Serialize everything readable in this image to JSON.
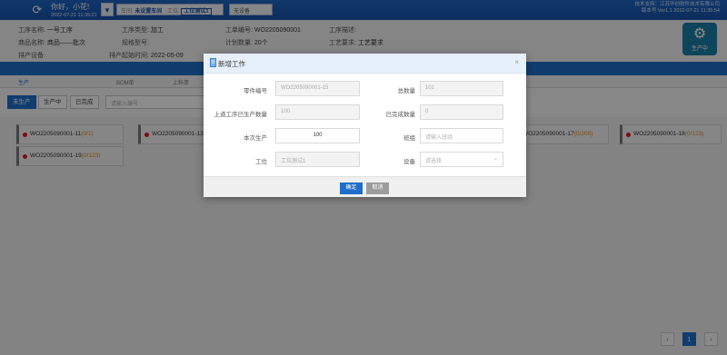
{
  "topbar": {
    "greeting": "你好，小花!",
    "datetime": "2022-07-21 11:35:21",
    "workshop_label": "车间:",
    "workshop_value": "未设置车间",
    "station_label": "工位:",
    "station_value": "工位测试1",
    "device_placeholder": "无设备",
    "company_line1": "技术支持：江苏华创软件技术有限公司",
    "company_line2": "版本号:Ver1.1 2022-07-21 11:35:54"
  },
  "info": {
    "process_name_k": "工序名称:",
    "process_name_v": "一号工序",
    "process_type_k": "工序类型:",
    "process_type_v": "加工",
    "order_no_k": "工单编号:",
    "order_no_v": "WO2205090001",
    "process_desc_k": "工序描述:",
    "process_desc_v": "",
    "product_name_k": "商品名称:",
    "product_name_v": "商品——批次",
    "spec_k": "规格型号:",
    "spec_v": "",
    "plan_qty_k": "计划数量:",
    "plan_qty_v": "20个",
    "proc_req_k": "工艺要求:",
    "proc_req_v": "工艺要求",
    "device_k": "排产设备:",
    "device_v": "",
    "start_time_k": "排产起始时间:",
    "start_time_v": "2022-05-09"
  },
  "gear_button": {
    "label": "生产中",
    "icon": "gear-icon"
  },
  "tabs": [
    "生产",
    "",
    "BOM单",
    "上料单",
    ""
  ],
  "filters": {
    "buttons": [
      "未生产",
      "生产中",
      "已完成"
    ],
    "search_placeholder": "请输入编号"
  },
  "cards": [
    {
      "code": "WO2205090001-11",
      "progress": "(0/1)"
    },
    {
      "code": "WO2205090001-13",
      "progress": ""
    },
    {
      "code": "WO2205090001-15",
      "progress": ""
    },
    {
      "code": "WO2205090001-17",
      "progress": "(0/200)"
    },
    {
      "code": "WO2205090001-18",
      "progress": "(0/123)"
    },
    {
      "code": "WO2205090001-19",
      "progress": "(0/123)"
    }
  ],
  "pagination": {
    "prev": "‹",
    "current": "1",
    "next": "›"
  },
  "modal": {
    "title": "新增工作",
    "close": "×",
    "fields": {
      "part_no_label": "零件编号",
      "part_no_value": "WO2205090001-15",
      "total_qty_label": "总数量",
      "total_qty_value": "101",
      "prev_produced_label": "上道工序已生产数量",
      "prev_produced_value": "100",
      "completed_label": "已完成数量",
      "completed_value": "0",
      "this_prod_label": "本次生产",
      "this_prod_value": "100",
      "team_label": "班组",
      "team_placeholder": "请输入班组",
      "station_label": "工位",
      "station_value": "工位测试1",
      "device_label": "设备",
      "device_placeholder": "请选择"
    },
    "ok_label": "确定",
    "cancel_label": "取消"
  },
  "colors": {
    "primary": "#1f6ec9",
    "header": "#1752a8",
    "alert_dot": "#e0191b",
    "progress": "#e08a1c"
  }
}
